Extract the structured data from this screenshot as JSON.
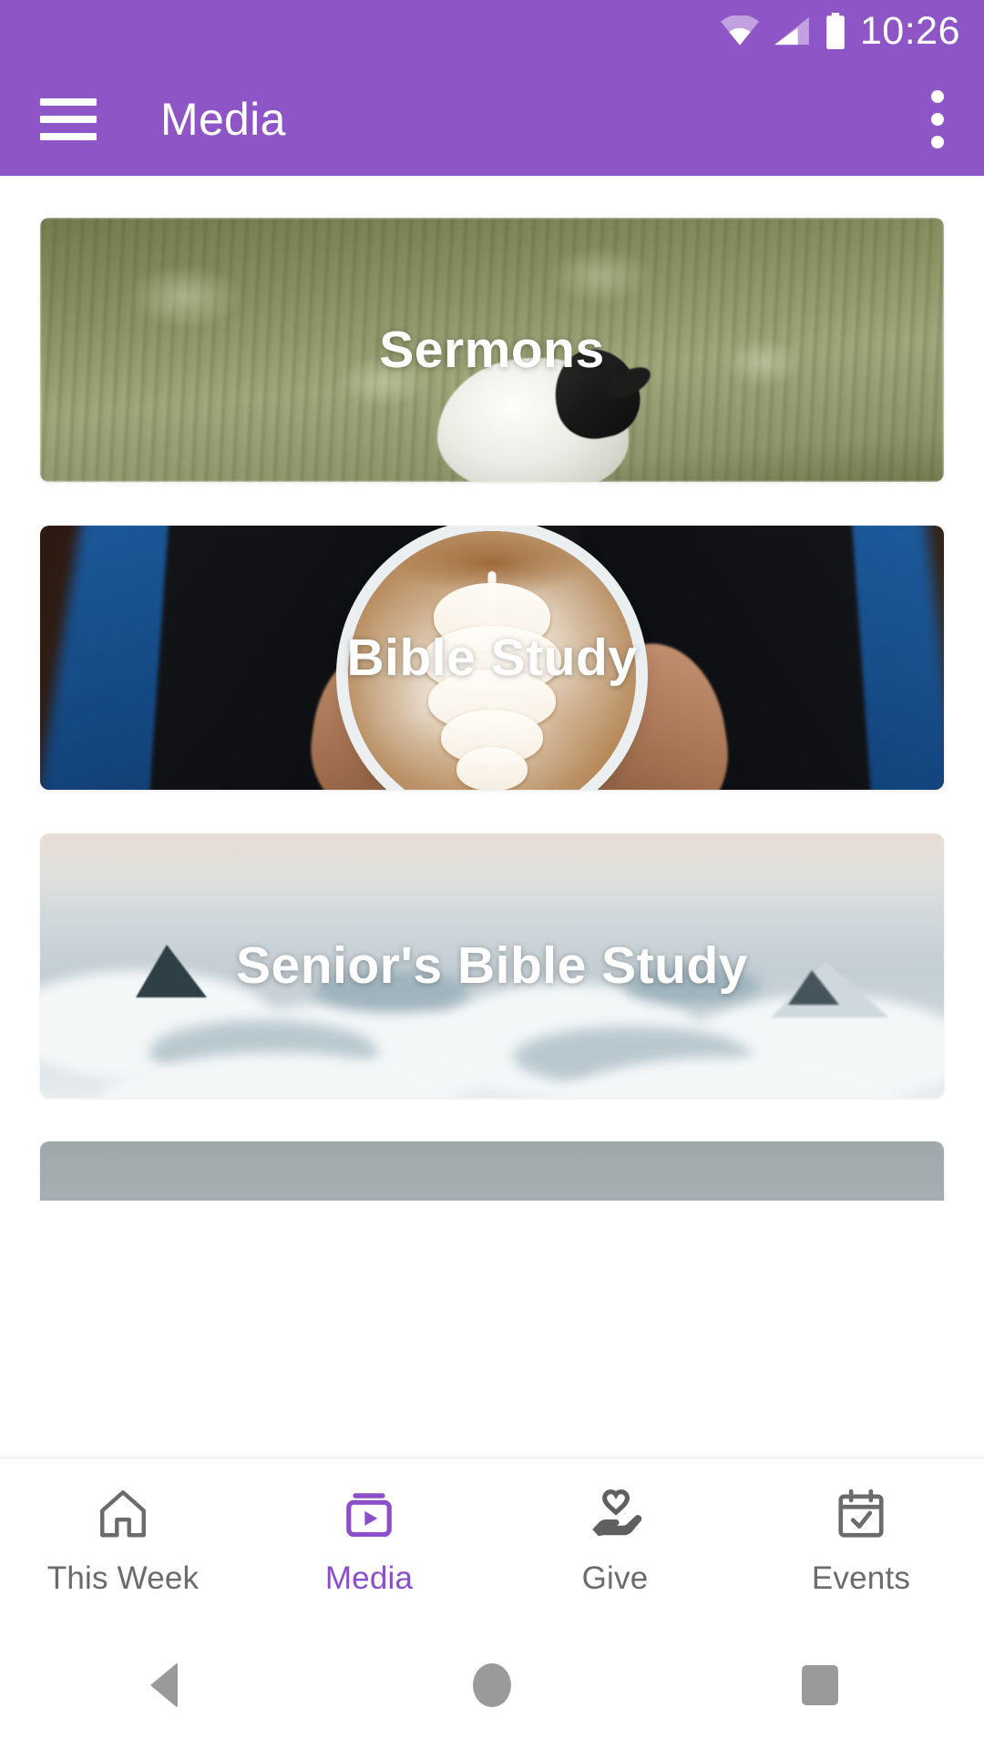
{
  "status_bar": {
    "time": "10:26",
    "icons": [
      "wifi-icon",
      "cellular-signal-icon",
      "battery-icon"
    ]
  },
  "app_bar": {
    "menu_icon": "hamburger-menu-icon",
    "title": "Media",
    "overflow_icon": "overflow-menu-icon",
    "background_color": "#8e55c6"
  },
  "media_cards": [
    {
      "title": "Sermons",
      "image": "sheep-in-grass-field",
      "partial": false
    },
    {
      "title": "Bible Study",
      "image": "hands-holding-latte-cup",
      "partial": false
    },
    {
      "title": "Senior's Bible Study",
      "image": "clouds-above-mountain-peaks",
      "partial": false
    },
    {
      "title": "",
      "image": "rocky-mountain-peak-sky",
      "partial": true
    }
  ],
  "bottom_nav": {
    "active_color": "#8b4fc9",
    "inactive_color": "#6b6b6b",
    "items": [
      {
        "label": "This Week",
        "icon": "home-icon",
        "active": false
      },
      {
        "label": "Media",
        "icon": "video-library-icon",
        "active": true
      },
      {
        "label": "Give",
        "icon": "hand-heart-icon",
        "active": false
      },
      {
        "label": "Events",
        "icon": "calendar-check-icon",
        "active": false
      }
    ]
  },
  "system_nav": {
    "back": "back-triangle-icon",
    "home": "home-circle-icon",
    "recents": "recents-square-icon"
  }
}
